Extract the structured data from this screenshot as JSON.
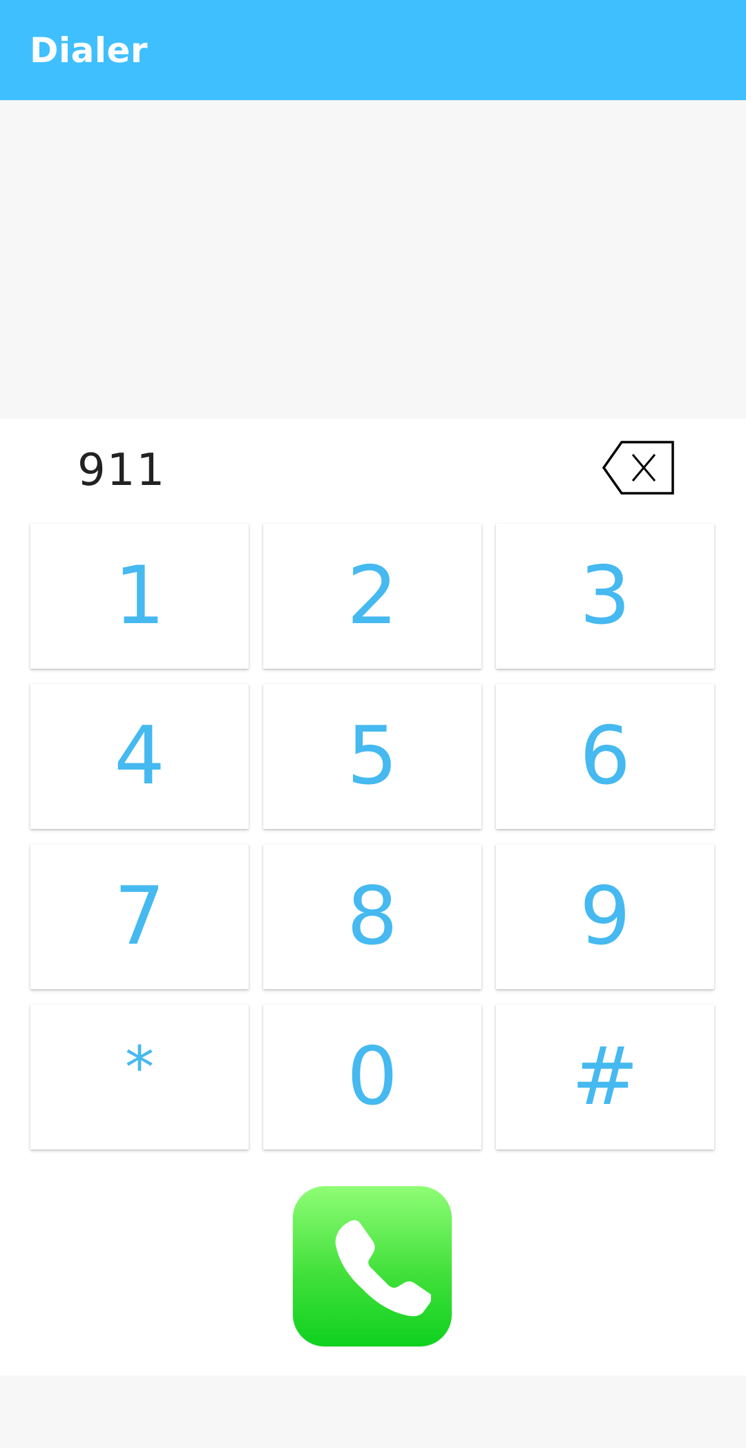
{
  "app": {
    "title": "Dialer",
    "accent_color": "#40bfff",
    "key_text_color": "#45b9f0",
    "call_button_color": "#0fd11f"
  },
  "dialer": {
    "number": "911",
    "backspace_icon": "backspace-icon",
    "call_icon": "phone-icon"
  },
  "keypad": {
    "keys": [
      "1",
      "2",
      "3",
      "4",
      "5",
      "6",
      "7",
      "8",
      "9",
      "*",
      "0",
      "#"
    ]
  }
}
